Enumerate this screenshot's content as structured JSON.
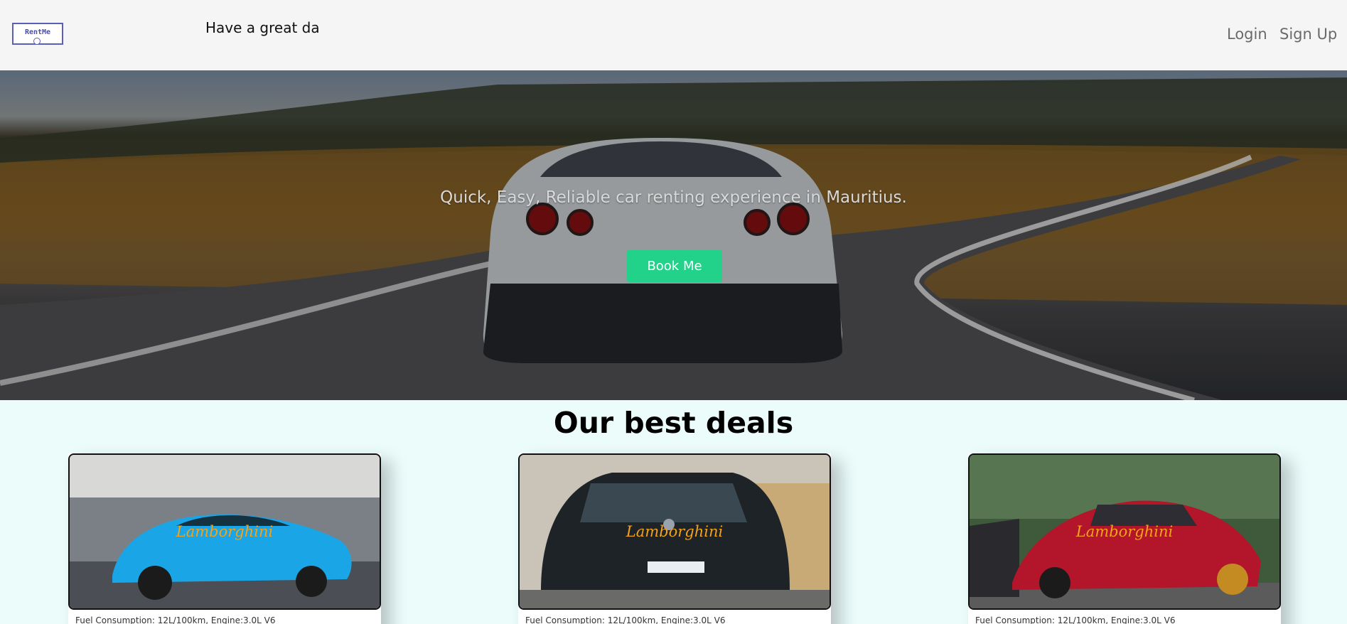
{
  "header": {
    "logo_text": "RentMe",
    "greeting": "Have a great da",
    "nav": {
      "login": "Login",
      "signup": "Sign Up"
    }
  },
  "hero": {
    "tagline": "Quick, Easy, Reliable car renting experience in Mauritius.",
    "cta_label": "Book Me"
  },
  "deals": {
    "title": "Our best deals",
    "cards": [
      {
        "brand": "Lamborghini",
        "info": "Fuel Consumption: 12L/100km, Engine:3.0L V6",
        "car_color": "#1aa6e6",
        "bg_color": "#6b7280"
      },
      {
        "brand": "Lamborghini",
        "info": "Fuel Consumption: 12L/100km, Engine:3.0L V6",
        "car_color": "#1d2326",
        "bg_color": "#c9c3b8"
      },
      {
        "brand": "Lamborghini",
        "info": "Fuel Consumption: 12L/100km, Engine:3.0L V6",
        "car_color": "#b3152a",
        "bg_color": "#3f5a3a"
      }
    ]
  },
  "colors": {
    "accent": "#22d18a",
    "header_bg": "#f5f5f5",
    "page_bg": "#ebfcfb",
    "brand_text": "#f3a21a"
  }
}
